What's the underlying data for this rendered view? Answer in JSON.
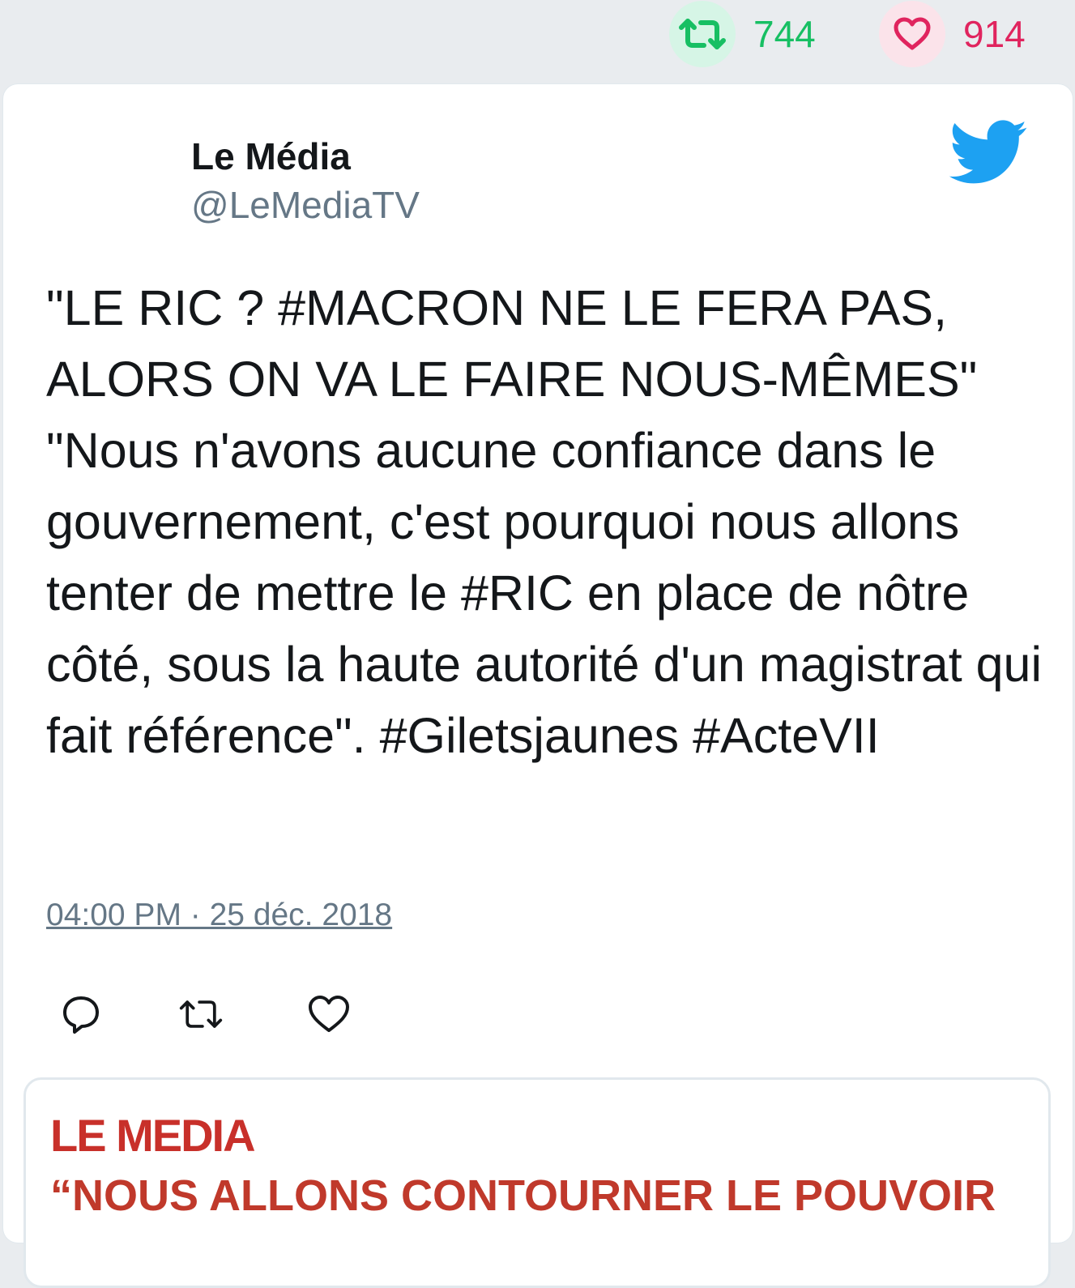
{
  "stats": {
    "retweets": "744",
    "likes": "914",
    "retweet_color": "#17bf63",
    "like_color": "#e0245e"
  },
  "author": {
    "name": "Le Média",
    "handle": "@LeMediaTV"
  },
  "tweet": {
    "text": "\"LE RIC ? #MACRON NE LE FERA PAS, ALORS ON VA LE FAIRE NOUS-MÊMES\" \"Nous n'avons aucune confiance dans le gouvernement, c'est pourquoi nous allons tenter de mettre le #RIC en place de nôtre côté, sous la haute autorité d'un magistrat qui fait référence\". #Giletsjaunes #ActeVII",
    "timestamp": "04:00 PM · 25 déc. 2018"
  },
  "icons": {
    "brand": "twitter-bird-icon",
    "reply": "reply-icon",
    "retweet": "retweet-icon",
    "like": "heart-icon"
  },
  "media": {
    "logo": "LE MEDIA",
    "headline": "“NOUS ALLONS CONTOURNER LE POUVOIR"
  },
  "colors": {
    "twitter_blue": "#1da1f2",
    "text": "#14171a",
    "muted": "#657786",
    "media_red": "#c0392b"
  }
}
